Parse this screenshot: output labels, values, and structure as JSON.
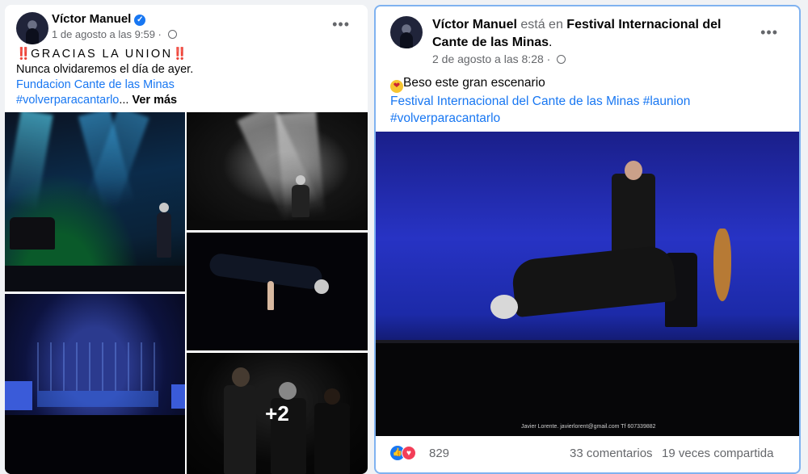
{
  "post1": {
    "author": "Víctor Manuel",
    "timestamp": "1 de agosto a las 9:59",
    "audience_icon": "globe-icon",
    "more_label": "•••",
    "lines": {
      "title_prefix": "‼️",
      "title": "GRACIAS LA UNION",
      "title_suffix": "‼️",
      "line2": "Nunca olvidaremos el día de ayer.",
      "line3": "Fundacion Cante de las Minas",
      "line4": "#volverparacantarlo",
      "ellipsis": "...",
      "see_more": "Ver más"
    },
    "extra_photos": "+2"
  },
  "post2": {
    "author": "Víctor Manuel",
    "is_at": "está en",
    "place": "Festival Internacional del Cante de las Minas",
    "place_end": ".",
    "timestamp": "2 de agosto a las 8:28",
    "more_label": "•••",
    "caption": "Beso este gran escenario",
    "hashtags_line1": "Festival Internacional del Cante de las Minas #launion",
    "hashtags_line2": "#volverparacantarlo",
    "photo_credit": "Javier Lorente. javierlorent@gmail.com  Tf 607339882",
    "reactions_count": "829",
    "comments": "33 comentarios",
    "shares": "19 veces compartida"
  },
  "colors": {
    "link": "#1877f2",
    "muted": "#65676b",
    "like": "#1877f2",
    "love": "#f33e58"
  }
}
